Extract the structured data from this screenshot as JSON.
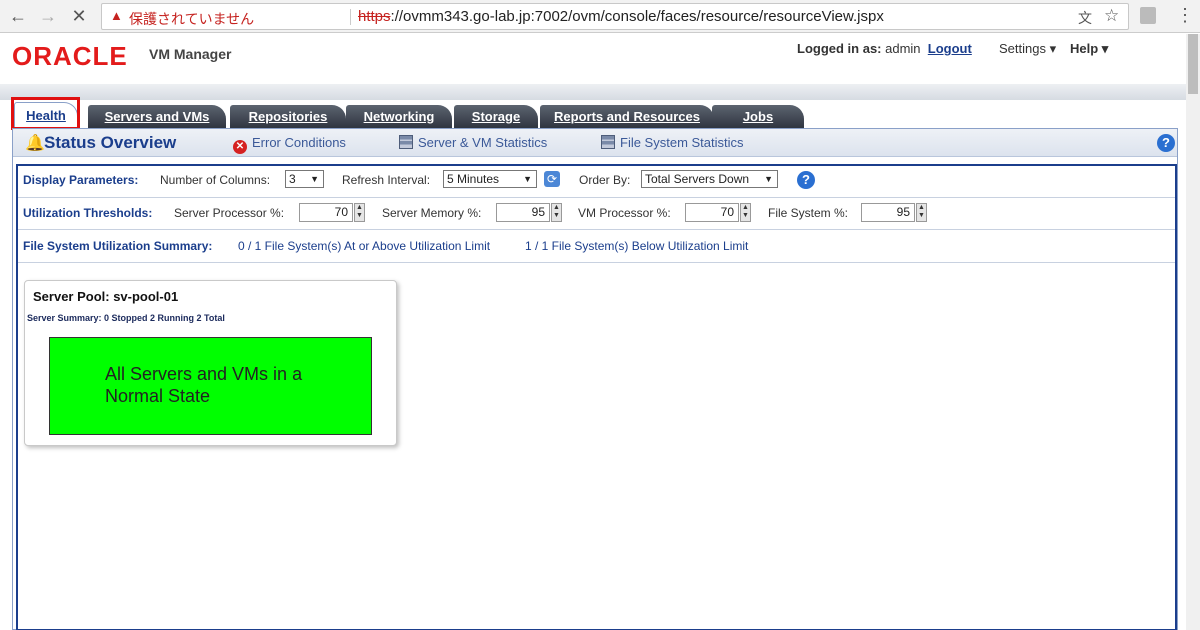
{
  "browser": {
    "insecure_label": "保護されていません",
    "url_scheme": "https",
    "url_rest": "://ovmm343.go-lab.jp:7002/ovm/console/faces/resource/resourceView.jspx"
  },
  "header": {
    "logo": "ORACLE",
    "product": "VM Manager",
    "logged_in_label": "Logged in as:",
    "user": "admin",
    "logout": "Logout",
    "settings": "Settings ▾",
    "help": "Help ▾"
  },
  "tabs": [
    {
      "label": "Health"
    },
    {
      "label": "Servers and VMs"
    },
    {
      "label": "Repositories"
    },
    {
      "label": "Networking"
    },
    {
      "label": "Storage"
    },
    {
      "label": "Reports and Resources"
    },
    {
      "label": "Jobs"
    }
  ],
  "status": {
    "title": "Status Overview",
    "links": [
      "Error Conditions",
      "Server & VM Statistics",
      "File System Statistics"
    ]
  },
  "display": {
    "label": "Display Parameters:",
    "columns_label": "Number of Columns:",
    "columns_value": "3",
    "refresh_label": "Refresh Interval:",
    "refresh_value": "5 Minutes",
    "order_label": "Order By:",
    "order_value": "Total Servers Down"
  },
  "thresholds": {
    "label": "Utilization Thresholds:",
    "server_processor_label": "Server Processor %:",
    "server_processor_value": "70",
    "server_memory_label": "Server Memory %:",
    "server_memory_value": "95",
    "vm_processor_label": "VM Processor %:",
    "vm_processor_value": "70",
    "file_system_label": "File System %:",
    "file_system_value": "95"
  },
  "fs_summary": {
    "label": "File System Utilization Summary:",
    "above": "0 / 1 File System(s) At or Above Utilization Limit",
    "below": "1 / 1 File System(s) Below Utilization Limit"
  },
  "pool": {
    "title": "Server Pool: sv-pool-01",
    "summary": "Server Summary: 0 Stopped 2 Running 2 Total",
    "message": "All Servers and VMs in a Normal State",
    "status_color": "#00ff00"
  }
}
